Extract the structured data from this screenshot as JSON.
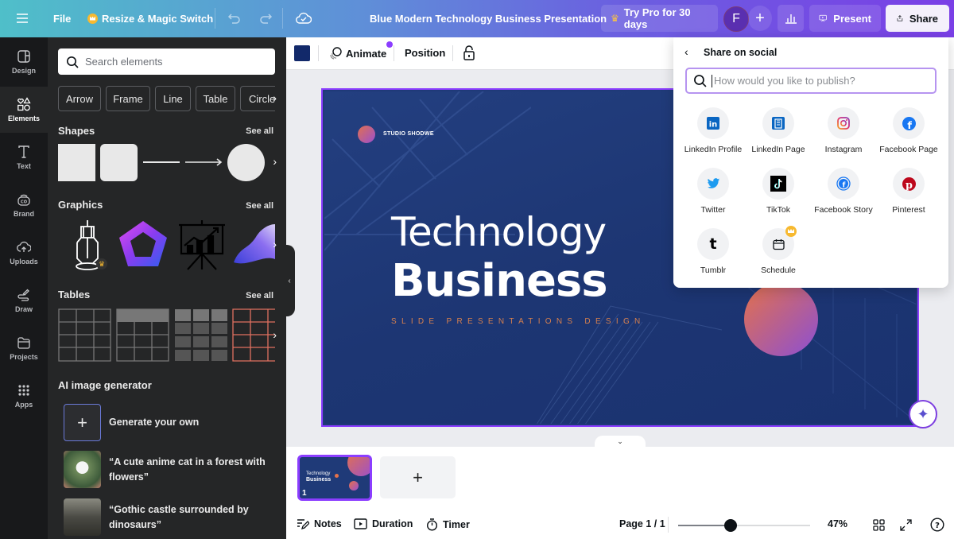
{
  "topbar": {
    "menu_icon": "hamburger-icon",
    "file_label": "File",
    "resize_label": "Resize & Magic Switch",
    "doc_title": "Blue Modern Technology Business Presentation",
    "try_pro_label": "Try Pro for 30 days",
    "avatar_initial": "F",
    "present_label": "Present",
    "share_label": "Share"
  },
  "rail": {
    "items": [
      {
        "label": "Design",
        "icon": "layout-icon"
      },
      {
        "label": "Elements",
        "icon": "shapes-icon",
        "active": true
      },
      {
        "label": "Text",
        "icon": "text-icon"
      },
      {
        "label": "Brand",
        "icon": "brand-icon"
      },
      {
        "label": "Uploads",
        "icon": "cloud-upload-icon"
      },
      {
        "label": "Draw",
        "icon": "pen-icon"
      },
      {
        "label": "Projects",
        "icon": "folder-icon"
      },
      {
        "label": "Apps",
        "icon": "grid-icon"
      }
    ]
  },
  "panel": {
    "search_placeholder": "Search elements",
    "chips": [
      "Arrow",
      "Frame",
      "Line",
      "Table",
      "Circle"
    ],
    "shapes_title": "Shapes",
    "graphics_title": "Graphics",
    "tables_title": "Tables",
    "see_all": "See all",
    "ai_title": "AI image generator",
    "ai_items": [
      {
        "label": "Generate your own"
      },
      {
        "label": "“A cute anime cat in a forest with flowers”"
      },
      {
        "label": "“Gothic castle surrounded by dinosaurs”"
      }
    ]
  },
  "toolbar": {
    "color": "#12296a",
    "animate_label": "Animate",
    "position_label": "Position"
  },
  "slide": {
    "brand": "STUDIO SHODWE",
    "title_line1": "Technology",
    "title_line2": "Business",
    "subtitle": "SLIDE PRESENTATIONS DESIGN",
    "thumb_line1": "Technology",
    "thumb_line2": "Business",
    "page_number": "1"
  },
  "footer": {
    "notes_label": "Notes",
    "duration_label": "Duration",
    "timer_label": "Timer",
    "page_indicator": "Page 1 / 1",
    "zoom_value": 0.47,
    "zoom_label": "47%"
  },
  "share_popover": {
    "title": "Share on social",
    "search_placeholder": "How would you like to publish?",
    "options": [
      {
        "label": "LinkedIn Profile",
        "icon": "linkedin-icon",
        "color": "#0a66c2"
      },
      {
        "label": "LinkedIn Page",
        "icon": "linkedin-page-icon",
        "color": "#0a66c2"
      },
      {
        "label": "Instagram",
        "icon": "instagram-icon",
        "color": "#e1306c"
      },
      {
        "label": "Facebook Page",
        "icon": "facebook-icon",
        "color": "#1877f2"
      },
      {
        "label": "Twitter",
        "icon": "twitter-icon",
        "color": "#1d9bf0"
      },
      {
        "label": "TikTok",
        "icon": "tiktok-icon",
        "color": "#000000"
      },
      {
        "label": "Facebook Story",
        "icon": "facebook-story-icon",
        "color": "#1877f2"
      },
      {
        "label": "Pinterest",
        "icon": "pinterest-icon",
        "color": "#bd081c"
      },
      {
        "label": "Tumblr",
        "icon": "tumblr-icon",
        "color": "#000000"
      },
      {
        "label": "Schedule",
        "icon": "calendar-icon",
        "pro": true
      }
    ]
  },
  "colors": {
    "accent": "#8b3dff",
    "slide_bg": "#1f3a78",
    "subtitle": "#d7804e",
    "pro_gold": "#f7b930"
  }
}
